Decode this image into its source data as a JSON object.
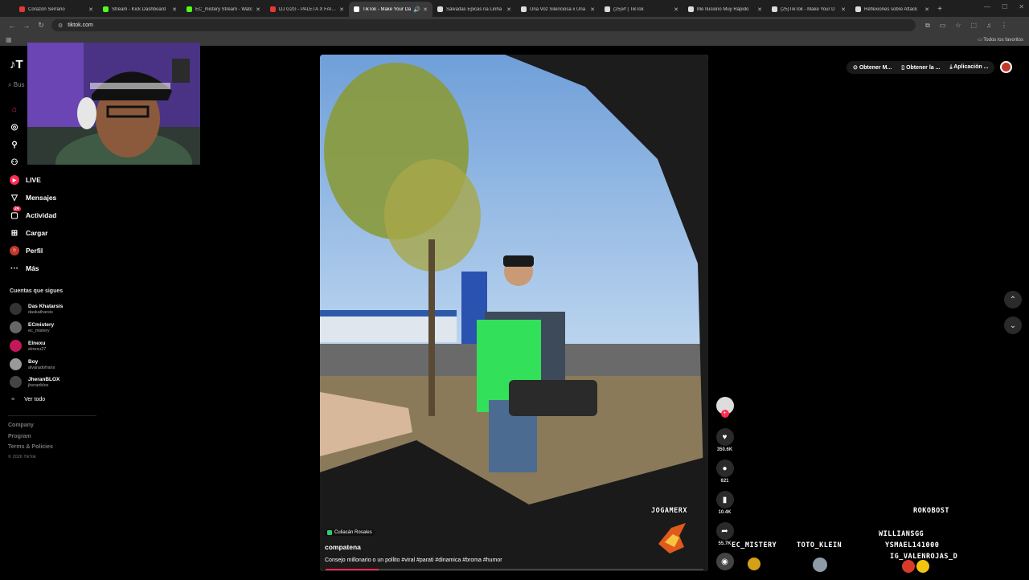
{
  "browser": {
    "tabs": [
      {
        "title": "Corazón Serrano",
        "color": "#e53935"
      },
      {
        "title": "Stream - Kick Dashboard",
        "color": "#53fc18"
      },
      {
        "title": "EC_mistery Stream - Watc",
        "color": "#53fc18"
      },
      {
        "title": "DJ G2G - PALETA X FAINT",
        "color": "#e53935"
      },
      {
        "title": "TikTok - Make Your Da",
        "color": "#ffffff",
        "active": true
      },
      {
        "title": "Salvadas Épicas na Linha",
        "color": "#ffffff"
      },
      {
        "title": "Una Voz Silenciosa x Una",
        "color": "#ffffff"
      },
      {
        "title": "(25)#f | TikTok",
        "color": "#ffffff"
      },
      {
        "title": "Me Ilusiono Muy Rápido",
        "color": "#ffffff"
      },
      {
        "title": "(25)TikTok - Make Your D",
        "color": "#ffffff"
      },
      {
        "title": "Reflexiones sobre Attack",
        "color": "#ffffff"
      }
    ],
    "url": "tiktok.com",
    "bookmarks_folder": "Todos los favoritos"
  },
  "sidebar": {
    "logo": "T",
    "search_placeholder": "Bus",
    "nav": [
      {
        "label": "LIVE",
        "icon": "live-icon"
      },
      {
        "label": "Mensajes",
        "icon": "send-icon"
      },
      {
        "label": "Actividad",
        "icon": "inbox-icon",
        "badge": "24"
      },
      {
        "label": "Cargar",
        "icon": "plus-square-icon"
      },
      {
        "label": "Perfil",
        "icon": "profile-icon"
      },
      {
        "label": "Más",
        "icon": "more-icon"
      }
    ],
    "following_title": "Cuentas que sigues",
    "following": [
      {
        "name": "Das Khatarsis",
        "handle": "daskatharsis"
      },
      {
        "name": "ECmistery",
        "handle": "ec_mistery"
      },
      {
        "name": "Elnexu",
        "handle": "elnexu27"
      },
      {
        "name": "Boy",
        "handle": "alvaradofrans"
      },
      {
        "name": "JheranBLOX",
        "handle": "jheranblox"
      }
    ],
    "see_all": "Ver todo",
    "footer": {
      "company": "Company",
      "program": "Program",
      "terms": "Terms & Policies",
      "copyright": "© 2026 TikTok"
    }
  },
  "video": {
    "location": "Culiacán Rosales",
    "username": "compatena",
    "caption": "Consejo millonario o un pollito #viral #parati #dinamica #broma #humor",
    "progress": 0.14
  },
  "actions": {
    "likes": "350.6K",
    "comments": "621",
    "saves": "10.4K",
    "shares": "55.7K"
  },
  "topbar": {
    "btn1": "Obtener M...",
    "btn2": "Obtener la ...",
    "btn3": "Aplicación ..."
  },
  "overlay": {
    "names": [
      "JOGAMERX",
      "ROKOBOST",
      "WILLIANSGG",
      "YSMAEL141000",
      "IG_VALENROJAS_D",
      "EC_MISTERY",
      "TOTO_KLEIN"
    ]
  }
}
